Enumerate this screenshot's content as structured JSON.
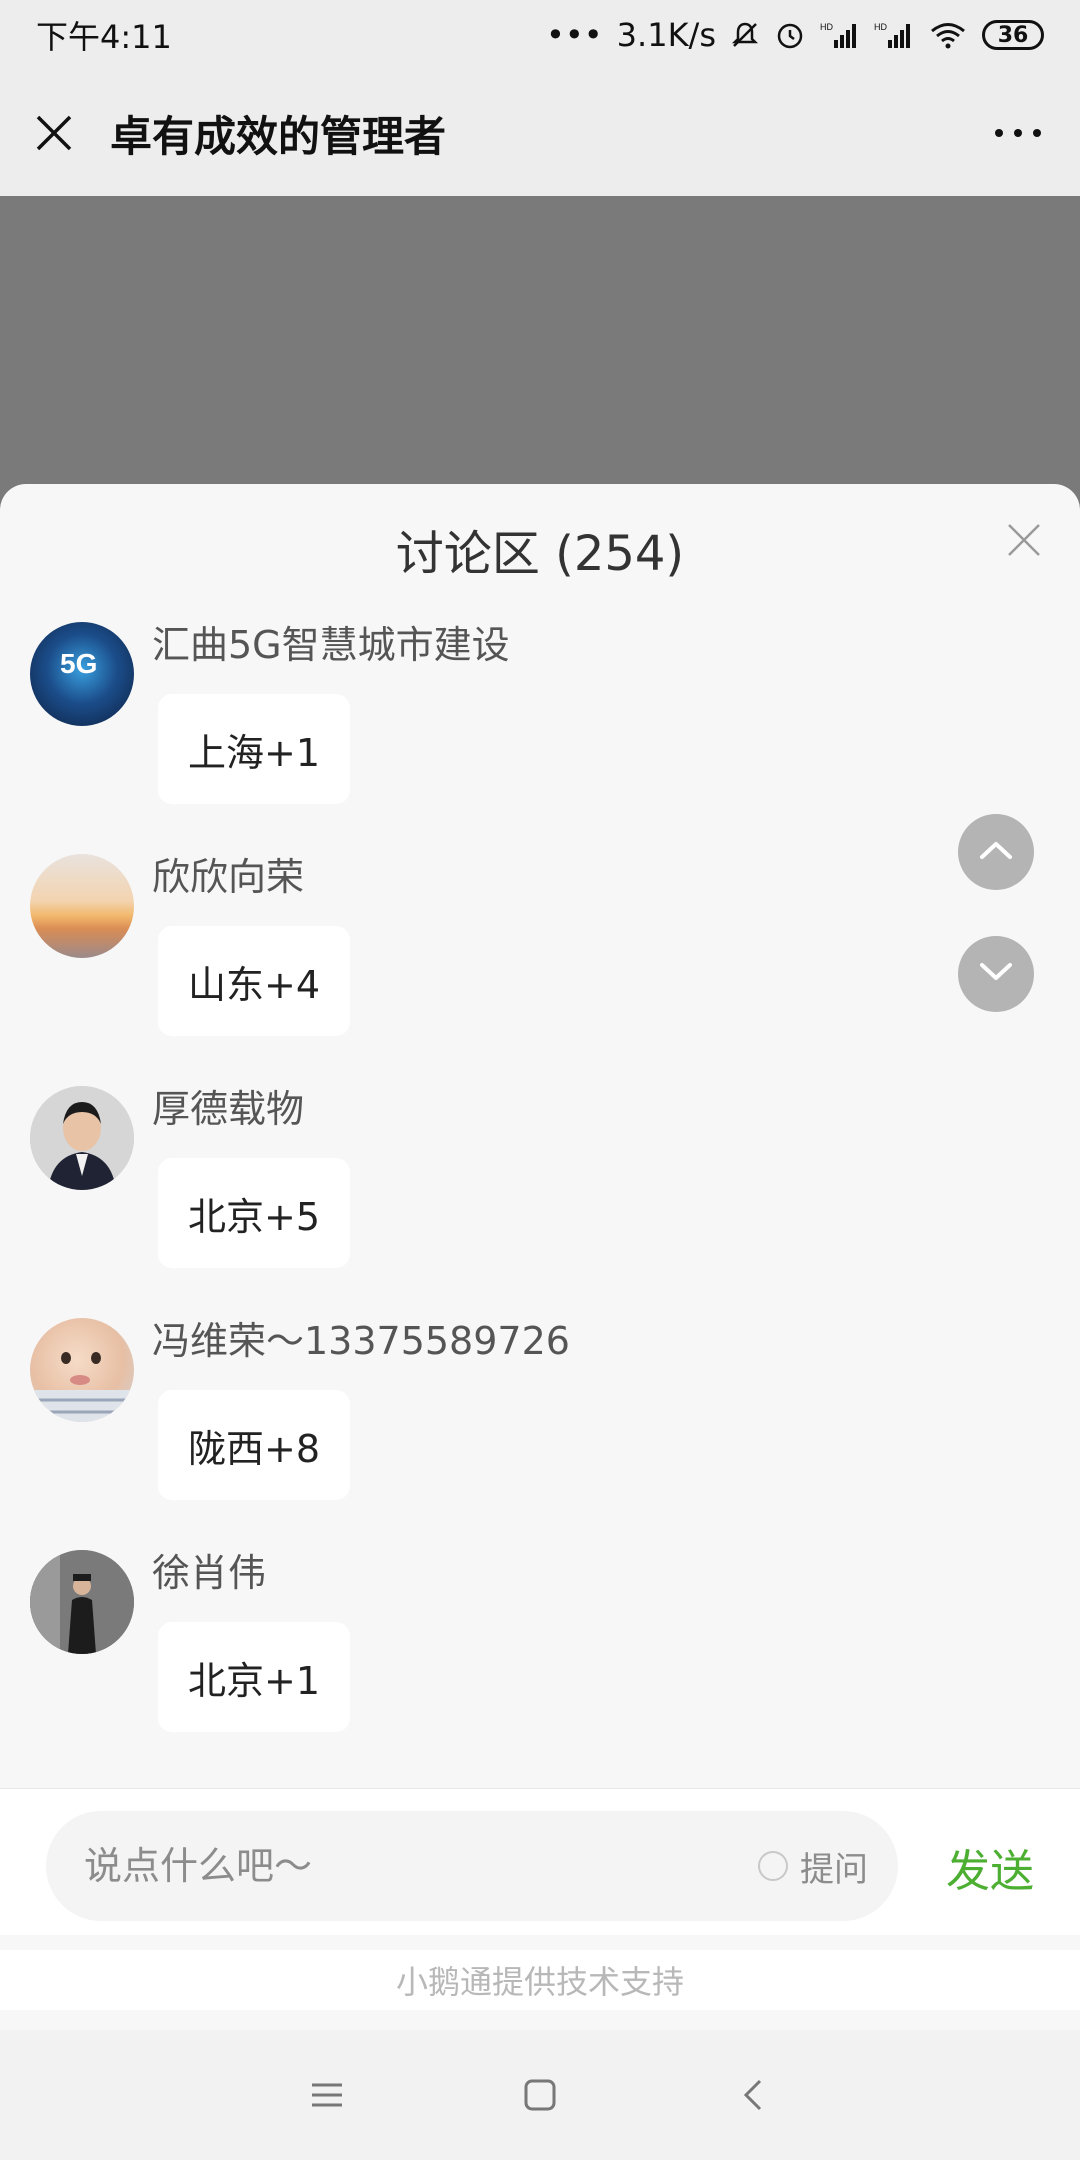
{
  "status_bar": {
    "time": "下午4:11",
    "network_speed": "3.1K/s",
    "battery": "36",
    "icons": [
      "mute-icon",
      "alarm-icon",
      "signal-hd-icon",
      "signal-hd-icon",
      "wifi-icon",
      "battery-icon"
    ]
  },
  "header": {
    "title": "卓有成效的管理者",
    "close_icon": "close-icon",
    "more_icon": "more-icon"
  },
  "discussion": {
    "title": "讨论区 (254)",
    "close_icon": "close-icon",
    "messages": [
      {
        "name": "汇曲5G智慧城市建设",
        "text": "上海+1",
        "avatar_text": "5G"
      },
      {
        "name": "欣欣向荣",
        "text": "山东+4"
      },
      {
        "name": "厚德载物",
        "text": "北京+5"
      },
      {
        "name": "冯维荣～13375589726",
        "text": "陇西+8"
      },
      {
        "name": "徐肖伟",
        "text": "北京+1"
      }
    ],
    "scroll_up_icon": "chevron-up-icon",
    "scroll_down_icon": "chevron-down-icon"
  },
  "input": {
    "placeholder": "说点什么吧～",
    "question_label": "提问",
    "send_label": "发送"
  },
  "footer": {
    "powered_by": "小鹅通提供技术支持"
  },
  "system_nav": {
    "menu_icon": "menu-icon",
    "home_icon": "home-icon",
    "back_icon": "back-icon"
  },
  "colors": {
    "accent_send": "#4caf32",
    "sheet_background": "#f7f7f7",
    "overlay": "#7a7a7a"
  }
}
